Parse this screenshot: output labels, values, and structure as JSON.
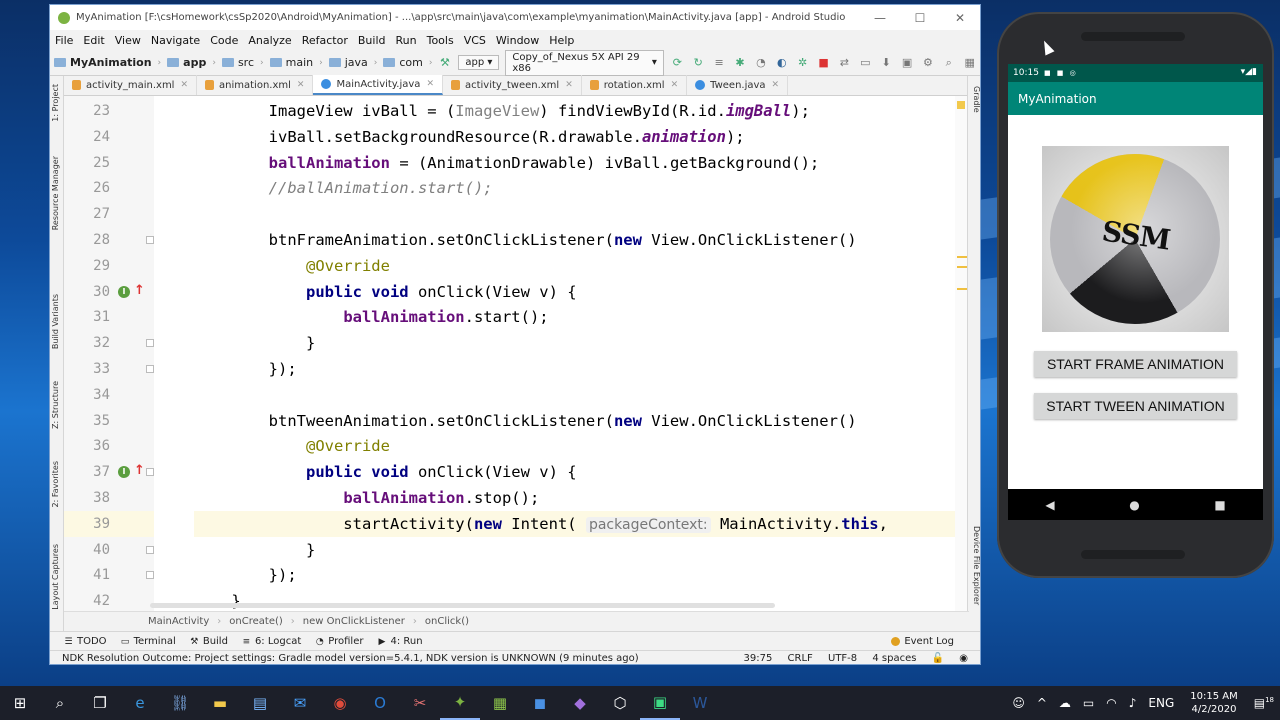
{
  "window": {
    "title": "MyAnimation [F:\\csHomework\\csSp2020\\Android\\MyAnimation] - ...\\app\\src\\main\\java\\com\\example\\myanimation\\MainActivity.java [app] - Android Studio",
    "min": "—",
    "max": "☐",
    "close": "✕"
  },
  "menu": [
    "File",
    "Edit",
    "View",
    "Navigate",
    "Code",
    "Analyze",
    "Refactor",
    "Build",
    "Run",
    "Tools",
    "VCS",
    "Window",
    "Help"
  ],
  "nav": {
    "project": "MyAnimation",
    "crumbs": [
      "app",
      "src",
      "main",
      "java",
      "com"
    ],
    "run_config": "app",
    "device": "Copy_of_Nexus 5X API 29 x86"
  },
  "tabs": [
    {
      "label": "activity_main.xml",
      "kind": "xml"
    },
    {
      "label": "animation.xml",
      "kind": "xml"
    },
    {
      "label": "MainActivity.java",
      "kind": "class",
      "active": true
    },
    {
      "label": "activity_tween.xml",
      "kind": "xml"
    },
    {
      "label": "rotation.xml",
      "kind": "xml"
    },
    {
      "label": "Tween.java",
      "kind": "class"
    }
  ],
  "left_strip": [
    "1: Project",
    "Resource Manager",
    "Build Variants",
    "Z: Structure",
    "2: Favorites",
    "Layout Captures"
  ],
  "right_strip": [
    "Gradle",
    "Device File Explorer"
  ],
  "code": {
    "line_numbers": [
      "23",
      "24",
      "25",
      "26",
      "27",
      "28",
      "29",
      "30",
      "31",
      "32",
      "33",
      "34",
      "35",
      "36",
      "37",
      "38",
      "39",
      "40",
      "41",
      "42"
    ],
    "lines": [
      [
        [
          "",
          "        "
        ],
        [
          "",
          "ImageView ivBall = ("
        ],
        [
          "gray",
          "ImageView"
        ],
        [
          "",
          ") findViewById(R.id."
        ],
        [
          "itf",
          "imgBall"
        ],
        [
          "",
          ");"
        ]
      ],
      [
        [
          "",
          "        ivBall.setBackgroundResource(R.drawable."
        ],
        [
          "itf",
          "animation"
        ],
        [
          "",
          ");"
        ]
      ],
      [
        [
          "",
          "        "
        ],
        [
          "fld",
          "ballAnimation"
        ],
        [
          "",
          " = (AnimationDrawable) ivBall.getBackground();"
        ]
      ],
      [
        [
          "cmt",
          "        //ballAnimation.start();"
        ]
      ],
      [
        [
          "",
          ""
        ]
      ],
      [
        [
          "",
          "        btnFrameAnimation.setOnClickListener("
        ],
        [
          "kw",
          "new"
        ],
        [
          "",
          " View.OnClickListener()"
        ]
      ],
      [
        [
          "ann",
          "            @Override"
        ]
      ],
      [
        [
          "",
          "            "
        ],
        [
          "kw",
          "public void"
        ],
        [
          "",
          " onClick(View v) {"
        ]
      ],
      [
        [
          "",
          "                "
        ],
        [
          "fld",
          "ballAnimation"
        ],
        [
          "",
          ".start();"
        ]
      ],
      [
        [
          "",
          "            }"
        ]
      ],
      [
        [
          "",
          "        });"
        ]
      ],
      [
        [
          "",
          ""
        ]
      ],
      [
        [
          "",
          "        btnTweenAnimation.setOnClickListener("
        ],
        [
          "kw",
          "new"
        ],
        [
          "",
          " View.OnClickListener()"
        ]
      ],
      [
        [
          "ann",
          "            @Override"
        ]
      ],
      [
        [
          "",
          "            "
        ],
        [
          "kw",
          "public void"
        ],
        [
          "",
          " onClick(View v) {"
        ]
      ],
      [
        [
          "",
          "                "
        ],
        [
          "fld",
          "ballAnimation"
        ],
        [
          "",
          ".stop();"
        ]
      ],
      [
        [
          "",
          "                startActivity("
        ],
        [
          "kw",
          "new"
        ],
        [
          "",
          " Intent( "
        ],
        [
          "hint",
          "packageContext:"
        ],
        [
          "",
          " MainActivity."
        ],
        [
          "kw",
          "this"
        ],
        [
          "",
          ","
        ]
      ],
      [
        [
          "",
          "            }"
        ]
      ],
      [
        [
          "",
          "        });"
        ]
      ],
      [
        [
          "",
          "    }"
        ]
      ]
    ]
  },
  "breadcrumb": [
    "MainActivity",
    "onCreate()",
    "new OnClickListener",
    "onClick()"
  ],
  "tool_windows": [
    "TODO",
    "Terminal",
    "Build",
    "6: Logcat",
    "Profiler",
    "4: Run"
  ],
  "event_log": "Event Log",
  "status": {
    "message": "NDK Resolution Outcome: Project settings: Gradle model version=5.4.1, NDK version is UNKNOWN (9 minutes ago)",
    "position": "39:75",
    "line_sep": "CRLF",
    "encoding": "UTF-8",
    "indent": "4 spaces"
  },
  "emulator": {
    "time": "10:15",
    "app_title": "MyAnimation",
    "logo_text": "SSM",
    "btn_frame": "START FRAME ANIMATION",
    "btn_tween": "START TWEEN ANIMATION"
  },
  "taskbar": {
    "lang": "ENG",
    "time": "10:15 AM",
    "date": "4/2/2020",
    "notif_count": "18"
  },
  "colors": {
    "appbar": "#008577",
    "statusbar": "#00574b",
    "keyword": "#000080",
    "field": "#660e7a"
  }
}
